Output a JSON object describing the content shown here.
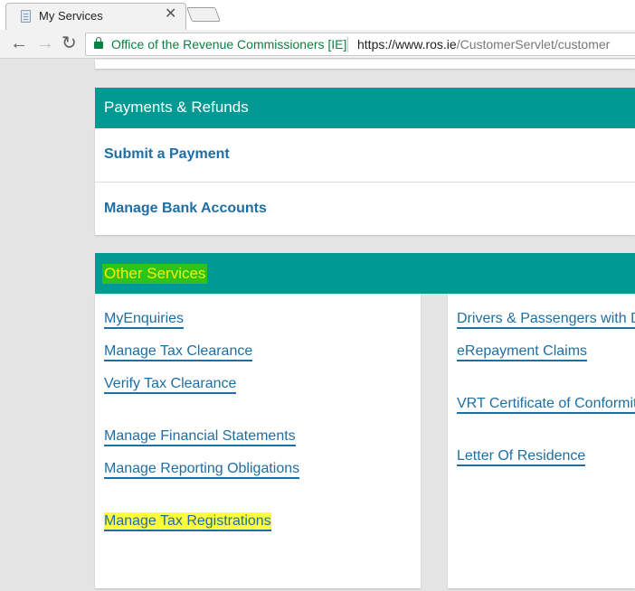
{
  "browser": {
    "tab_title": "My Services",
    "tab_close": "✕",
    "back_icon": "←",
    "forward_icon": "→",
    "reload_icon": "↻",
    "site_identity": "Office of the Revenue Commissioners [IE]",
    "url_host": "https://www.ros.ie",
    "url_path": "/CustomerServlet/customer"
  },
  "payments": {
    "header": "Payments & Refunds",
    "items": [
      "Submit a Payment",
      "Manage Bank Accounts"
    ]
  },
  "other_services": {
    "header": "Other Services",
    "left_links": [
      "MyEnquiries",
      "Manage Tax Clearance",
      "Verify Tax Clearance",
      "Manage Financial Statements",
      "Manage Reporting Obligations",
      "Manage Tax Registrations"
    ],
    "right_links": [
      "Drivers & Passengers with D",
      "eRepayment Claims",
      "VRT Certificate of Conformit",
      "Letter Of Residence"
    ]
  },
  "colors": {
    "teal_header": "#009a93",
    "link_blue": "#1f6ea3",
    "highlight_yellow": "#ffff3a",
    "highlight_green": "#2ec21c"
  }
}
